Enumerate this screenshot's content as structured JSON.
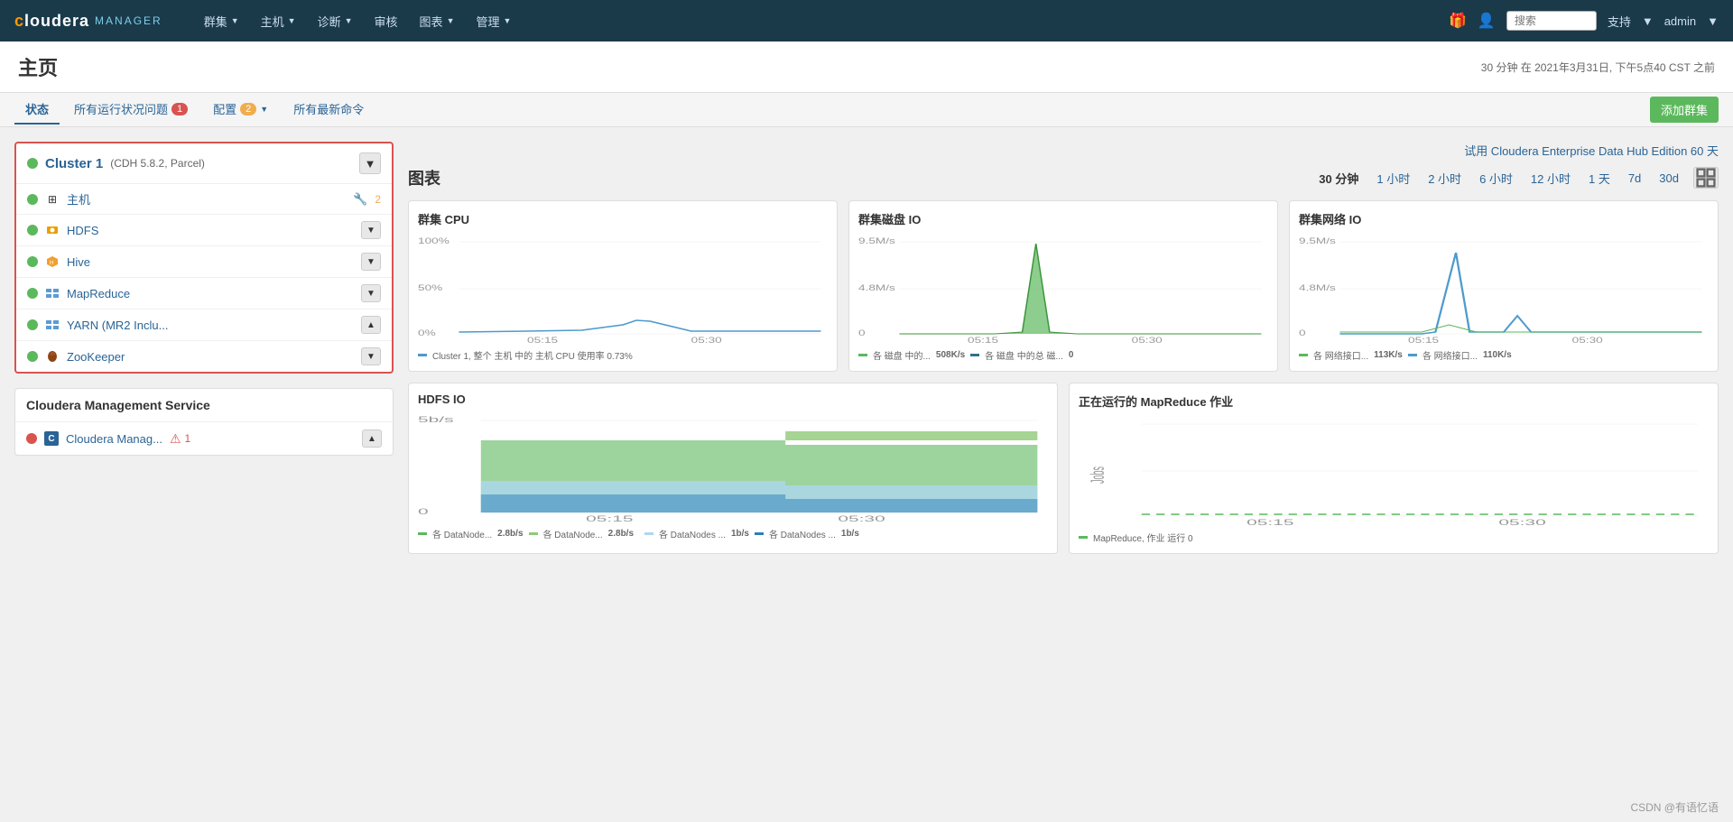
{
  "nav": {
    "logo_cloudera": "cloudera",
    "logo_highlight": "MANAGER",
    "menu_items": [
      {
        "label": "群集",
        "id": "clusters"
      },
      {
        "label": "主机",
        "id": "hosts"
      },
      {
        "label": "诊断",
        "id": "diagnostics"
      },
      {
        "label": "审核",
        "id": "audit"
      },
      {
        "label": "图表",
        "id": "charts"
      },
      {
        "label": "管理",
        "id": "admin"
      }
    ],
    "search_placeholder": "搜索",
    "support_label": "支持",
    "admin_label": "admin"
  },
  "page": {
    "title": "主页",
    "time_info": "30 分钟 在 2021年3月31日, 下午5点40 CST 之前"
  },
  "tabs": {
    "status": "状态",
    "runtime_issues": "所有运行状况问题",
    "runtime_badge": "1",
    "config": "配置",
    "config_badge": "2",
    "latest_commands": "所有最新命令",
    "add_cluster": "添加群集"
  },
  "enterprise_banner": "试用 Cloudera Enterprise Data Hub Edition 60 天",
  "cluster1": {
    "name": "Cluster 1",
    "version": "(CDH 5.8.2, Parcel)",
    "services": [
      {
        "name": "主机",
        "icon": "grid",
        "warn": "2",
        "has_warn": true
      },
      {
        "name": "HDFS",
        "icon": "hdfs",
        "has_dropdown": true
      },
      {
        "name": "Hive",
        "icon": "hive",
        "has_dropdown": true
      },
      {
        "name": "MapReduce",
        "icon": "mapreduce",
        "has_dropdown": true
      },
      {
        "name": "YARN (MR2 Inclu...",
        "icon": "yarn",
        "has_dropdown": true,
        "has_up": true
      },
      {
        "name": "ZooKeeper",
        "icon": "zookeeper",
        "has_dropdown": true
      }
    ]
  },
  "mgmt": {
    "title": "Cloudera Management Service",
    "service_name": "Cloudera Manag...",
    "error_count": "1"
  },
  "charts": {
    "title": "图表",
    "time_options": [
      "30 分钟",
      "1 小时",
      "2 小时",
      "6 小时",
      "12 小时",
      "1 天",
      "7d",
      "30d"
    ],
    "active_time": "30 分钟",
    "cluster_cpu": {
      "title": "群集 CPU",
      "y_labels": [
        "100%",
        "50%",
        "0%"
      ],
      "x_labels": [
        "05:15",
        "05:30"
      ],
      "legend": "Cluster 1, 整个 主机 中的 主机 CPU 使用率 0.73%"
    },
    "cluster_disk_io": {
      "title": "群集磁盘 IO",
      "y_labels": [
        "9.5M/s",
        "4.8M/s",
        "0"
      ],
      "x_labels": [
        "05:15",
        "05:30"
      ],
      "legend1": "各 磁盘 中的...",
      "legend1_val": "508K/s",
      "legend2": "各 磁盘 中的总 磁...",
      "legend2_val": "0"
    },
    "cluster_network_io": {
      "title": "群集网络 IO",
      "y_labels": [
        "9.5M/s",
        "4.8M/s",
        "0"
      ],
      "x_labels": [
        "05:15",
        "05:30"
      ],
      "legend1": "各 网络接口...",
      "legend1_val": "113K/s",
      "legend2": "各 网络接口...",
      "legend2_val": "110K/s"
    },
    "hdfs_io": {
      "title": "HDFS IO",
      "y_labels": [
        "5b/s",
        "0"
      ],
      "x_labels": [
        "05:15",
        "05:30"
      ],
      "legend1": "各 DataNode...",
      "legend1_val": "2.8b/s",
      "legend2": "各 DataNode...",
      "legend2_val": "2.8b/s",
      "legend3": "各 DataNodes ...",
      "legend3_val": "1b/s",
      "legend4": "各 DataNodes ...",
      "legend4_val": "1b/s"
    },
    "mapreduce_jobs": {
      "title": "正在运行的 MapReduce 作业",
      "y_label": "Jobs",
      "x_labels": [
        "05:15",
        "05:30"
      ],
      "legend": "MapReduce, 作业 运行 0"
    }
  },
  "footer": {
    "credit": "CSDN @有语忆语"
  }
}
